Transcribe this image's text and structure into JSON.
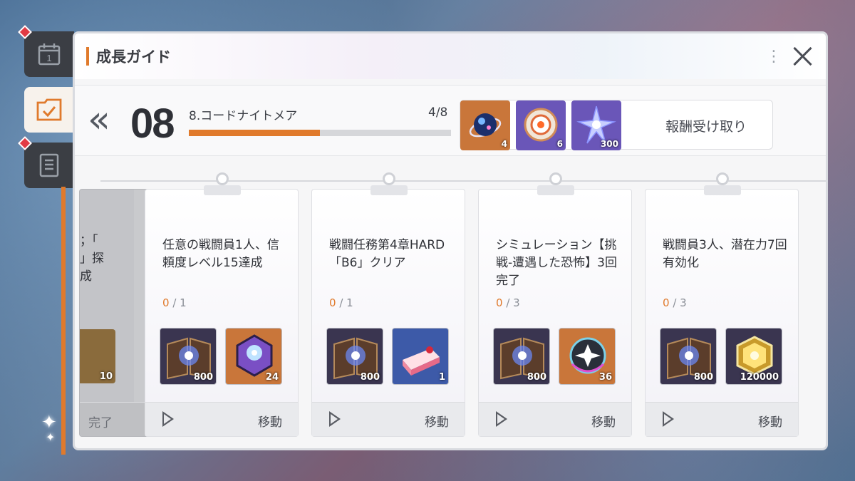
{
  "side_tabs": [
    {
      "icon": "calendar-icon",
      "label": "1",
      "badge": true
    },
    {
      "icon": "checklist-icon",
      "active": true
    },
    {
      "icon": "notebook-icon",
      "badge": true
    }
  ],
  "header": {
    "title": "成長ガイド"
  },
  "stage": {
    "number": "08",
    "name": "8.コードナイトメア",
    "progress_text": "4/8",
    "progress_fraction": 0.5,
    "rewards": [
      {
        "icon": "blue-orb-icon",
        "qty": "4",
        "bg": "#c9763a"
      },
      {
        "icon": "ring-disc-icon",
        "qty": "6",
        "bg": "#6a56b8"
      },
      {
        "icon": "crystal-star-icon",
        "qty": "300",
        "bg": "#6a56b8"
      }
    ],
    "claim_label": "報酬受け取り"
  },
  "partial_card": {
    "text_lines": [
      "；「",
      "」探",
      "成"
    ],
    "reward_qty": "10",
    "done_label": "完了"
  },
  "cards": [
    {
      "title": "任意の戦闘員1人、信頼度レベル15達成",
      "current": "0",
      "total": "/ 1",
      "rewards": [
        {
          "icon": "book-icon",
          "qty": "800",
          "bg": "#3a3550"
        },
        {
          "icon": "purple-gem-icon",
          "qty": "24",
          "bg": "#c9763a"
        }
      ],
      "move_label": "移動"
    },
    {
      "title": "戦闘任務第4章HARD「B6」クリア",
      "current": "0",
      "total": "/ 1",
      "rewards": [
        {
          "icon": "book-icon",
          "qty": "800",
          "bg": "#3a3550"
        },
        {
          "icon": "cake-icon",
          "qty": "1",
          "bg": "#3d5aa8"
        }
      ],
      "move_label": "移動"
    },
    {
      "title": "シミュレーション【挑戦-遭遇した恐怖】3回完了",
      "current": "0",
      "total": "/ 3",
      "rewards": [
        {
          "icon": "book-icon",
          "qty": "800",
          "bg": "#3a3550"
        },
        {
          "icon": "dark-emblem-icon",
          "qty": "36",
          "bg": "#c9763a"
        }
      ],
      "move_label": "移動"
    },
    {
      "title": "戦闘員3人、潜在力7回有効化",
      "current": "0",
      "total": "/ 3",
      "rewards": [
        {
          "icon": "book-icon",
          "qty": "800",
          "bg": "#3a3550"
        },
        {
          "icon": "gold-chip-icon",
          "qty": "120000",
          "bg": "#3a3550"
        }
      ],
      "move_label": "移動"
    }
  ]
}
